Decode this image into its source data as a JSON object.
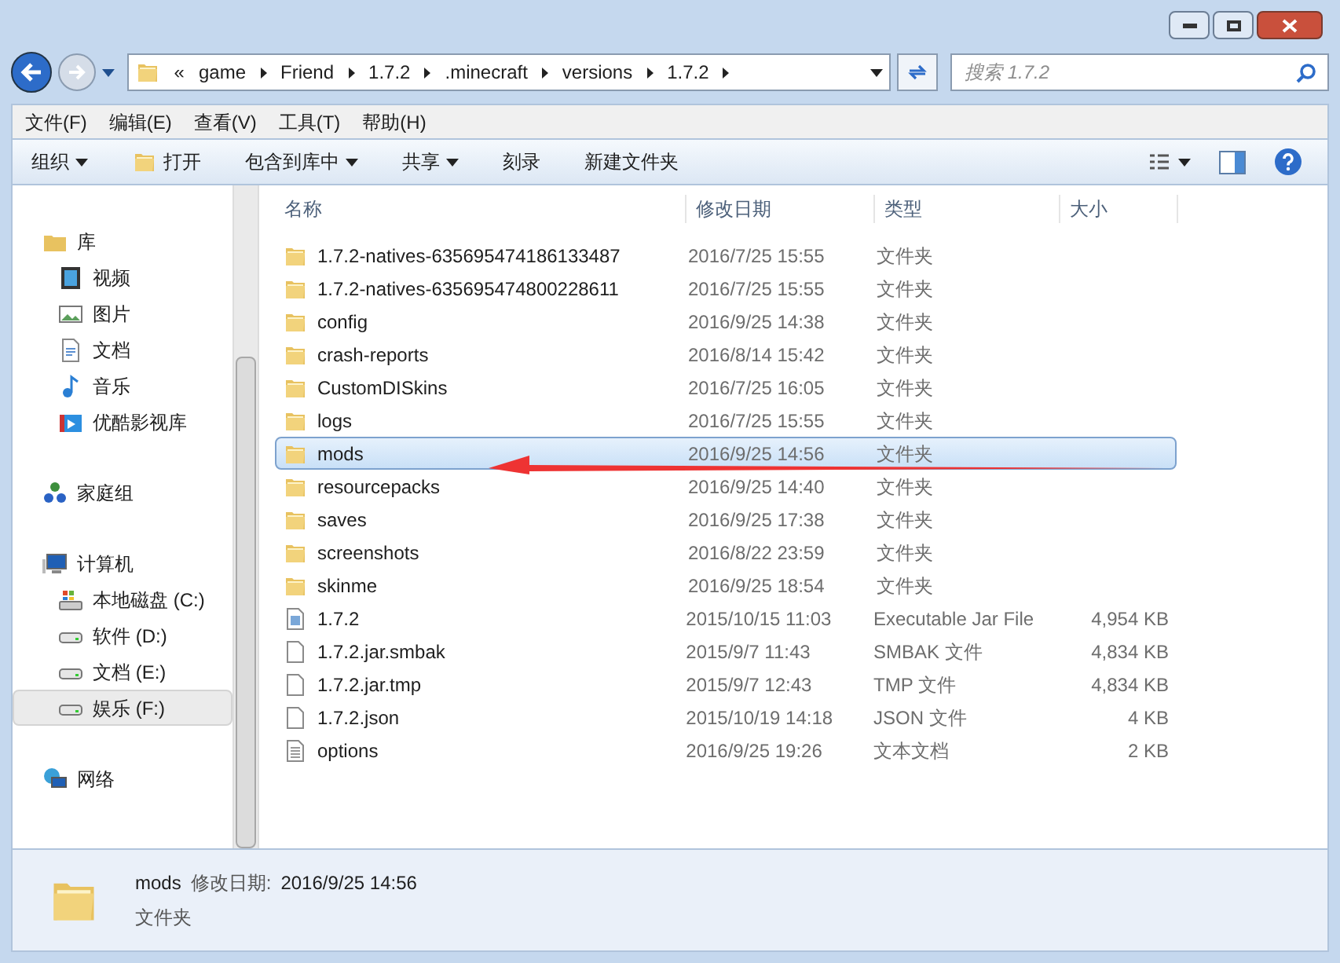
{
  "address_bar": {
    "overflow": "«",
    "crumbs": [
      "game",
      "Friend",
      "1.7.2",
      ".minecraft",
      "versions",
      "1.7.2"
    ]
  },
  "search": {
    "placeholder": "搜索 1.7.2"
  },
  "menu_bar": [
    "文件(F)",
    "编辑(E)",
    "查看(V)",
    "工具(T)",
    "帮助(H)"
  ],
  "toolbar": [
    {
      "label": "组织",
      "kind": "dropdown"
    },
    {
      "label": "打开",
      "kind": "open"
    },
    {
      "label": "包含到库中",
      "kind": "dropdown"
    },
    {
      "label": "共享",
      "kind": "dropdown"
    },
    {
      "label": "刻录",
      "kind": "plain"
    },
    {
      "label": "新建文件夹",
      "kind": "plain"
    }
  ],
  "sidebar": {
    "items": [
      {
        "label": "库",
        "kind": "library",
        "selected": false,
        "children": [
          {
            "label": "视频",
            "kind": "video",
            "selected": false
          },
          {
            "label": "图片",
            "kind": "picture",
            "selected": false
          },
          {
            "label": "文档",
            "kind": "document",
            "selected": false
          },
          {
            "label": "音乐",
            "kind": "music",
            "selected": false
          },
          {
            "label": "优酷影视库",
            "kind": "media",
            "selected": false
          }
        ]
      },
      {
        "label": "家庭组",
        "kind": "homegroup",
        "selected": false
      },
      {
        "label": "计算机",
        "kind": "computer",
        "selected": false,
        "children": [
          {
            "label": "本地磁盘 (C:)",
            "kind": "system-drive",
            "selected": false
          },
          {
            "label": "软件 (D:)",
            "kind": "drive",
            "selected": false
          },
          {
            "label": "文档 (E:)",
            "kind": "drive",
            "selected": false
          },
          {
            "label": "娱乐 (F:)",
            "kind": "drive",
            "selected": true
          }
        ]
      },
      {
        "label": "网络",
        "kind": "network",
        "selected": false
      }
    ]
  },
  "table": {
    "columns": [
      "名称",
      "修改日期",
      "类型",
      "大小"
    ],
    "rows": [
      {
        "name": "1.7.2-natives-635695474186133487",
        "date": "2016/7/25 15:55",
        "type": "文件夹",
        "kind": "folder",
        "selected": false
      },
      {
        "name": "1.7.2-natives-635695474800228611",
        "date": "2016/7/25 15:55",
        "type": "文件夹",
        "kind": "folder",
        "selected": false
      },
      {
        "name": "config",
        "date": "2016/9/25 14:38",
        "type": "文件夹",
        "kind": "folder",
        "selected": false
      },
      {
        "name": "crash-reports",
        "date": "2016/8/14 15:42",
        "type": "文件夹",
        "kind": "folder",
        "selected": false
      },
      {
        "name": "CustomDISkins",
        "date": "2016/7/25 16:05",
        "type": "文件夹",
        "kind": "folder",
        "selected": false
      },
      {
        "name": "logs",
        "date": "2016/7/25 15:55",
        "type": "文件夹",
        "kind": "folder",
        "selected": false
      },
      {
        "name": "mods",
        "date": "2016/9/25 14:56",
        "type": "文件夹",
        "kind": "folder",
        "selected": true
      },
      {
        "name": "resourcepacks",
        "date": "2016/9/25 14:40",
        "type": "文件夹",
        "kind": "folder",
        "selected": false
      },
      {
        "name": "saves",
        "date": "2016/9/25 17:38",
        "type": "文件夹",
        "kind": "folder",
        "selected": false
      },
      {
        "name": "screenshots",
        "date": "2016/8/22 23:59",
        "type": "文件夹",
        "kind": "folder",
        "selected": false
      },
      {
        "name": "skinme",
        "date": "2016/9/25 18:54",
        "type": "文件夹",
        "kind": "folder",
        "selected": false
      },
      {
        "name": "1.7.2",
        "date": "2015/10/15 11:03",
        "type": "Executable Jar File",
        "size": "4,954 KB",
        "kind": "jar",
        "selected": false
      },
      {
        "name": "1.7.2.jar.smbak",
        "date": "2015/9/7 11:43",
        "type": "SMBAK 文件",
        "size": "4,834 KB",
        "kind": "file",
        "selected": false
      },
      {
        "name": "1.7.2.jar.tmp",
        "date": "2015/9/7 12:43",
        "type": "TMP 文件",
        "size": "4,834 KB",
        "kind": "file",
        "selected": false
      },
      {
        "name": "1.7.2.json",
        "date": "2015/10/19 14:18",
        "type": "JSON 文件",
        "size": "4 KB",
        "kind": "file",
        "selected": false
      },
      {
        "name": "options",
        "date": "2016/9/25 19:26",
        "type": "文本文档",
        "size": "2 KB",
        "kind": "text",
        "selected": false
      }
    ]
  },
  "details_pane": {
    "name": "mods",
    "date_label": "修改日期:",
    "date": "2016/9/25 14:56",
    "type": "文件夹"
  }
}
